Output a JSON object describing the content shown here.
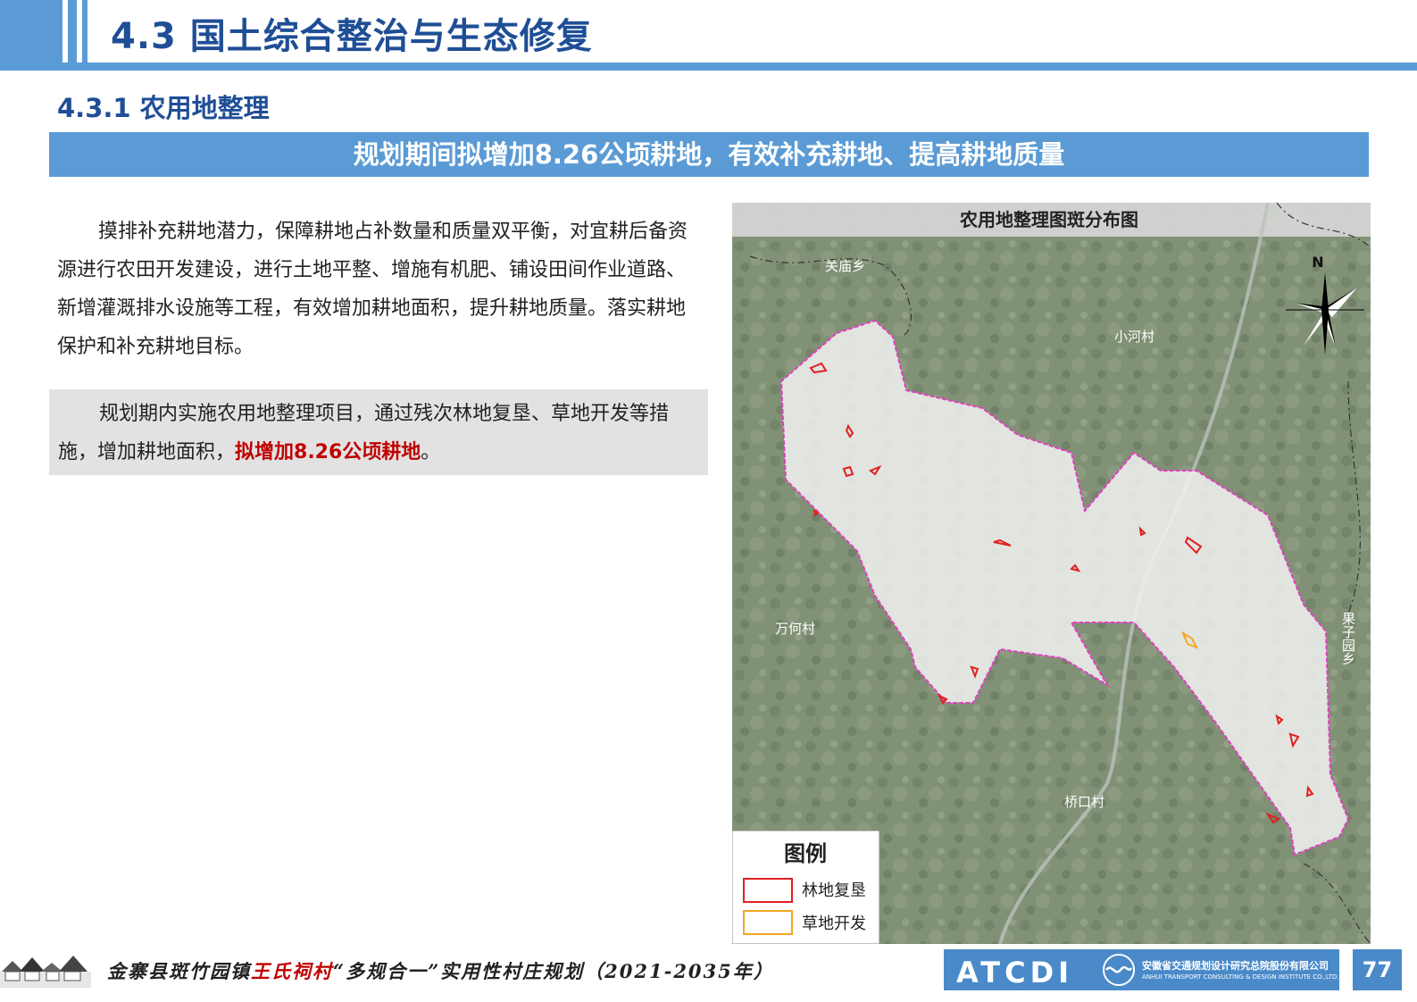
{
  "header": {
    "title": "4.3 国土综合整治与生态修复"
  },
  "section": {
    "title": "4.3.1 农用地整理"
  },
  "banner": {
    "text": "规划期间拟增加8.26公顷耕地，有效补充耕地、提高耕地质量"
  },
  "body": {
    "paragraph1": "摸排补充耕地潜力，保障耕地占补数量和质量双平衡，对宜耕后备资源进行农田开发建设，进行土地平整、增施有机肥、铺设田间作业道路、新增灌溉排水设施等工程，有效增加耕地面积，提升耕地质量。落实耕地保护和补充耕地目标。",
    "paragraph2_before": "规划期内实施农用地整理项目，通过残次林地复垦、草地开发等措施，增加耕地面积，",
    "paragraph2_highlight": "拟增加8.26公顷耕地",
    "paragraph2_after": "。"
  },
  "map": {
    "title": "农用地整理图斑分布图",
    "north_label": "N",
    "places": {
      "guanmiao": "关庙乡",
      "xiaohe": "小河村",
      "wanhe": "万何村",
      "qiaokou": "桥口村",
      "guoziyuan": "果子园乡"
    },
    "legend": {
      "title": "图例",
      "items": [
        {
          "label": "林地复垦",
          "color": "#e02020"
        },
        {
          "label": "草地开发",
          "color": "#f5a623"
        }
      ]
    },
    "colors": {
      "boundary": "#e040c0",
      "reclaim": "#e02020",
      "grassland": "#f5a623"
    }
  },
  "footer": {
    "title_before": "金寨县斑竹园镇",
    "title_red": "王氏祠村",
    "title_after": "“多规合一”实用性村庄规划（2021-2035年）",
    "logo_text": "ATCDI",
    "company_cn": "安徽省交通规划设计研究总院股份有限公司",
    "company_en": "ANHUI TRANSPORT CONSULTING & DESIGN INSTITUTE CO.,LTD.",
    "page": "77"
  }
}
